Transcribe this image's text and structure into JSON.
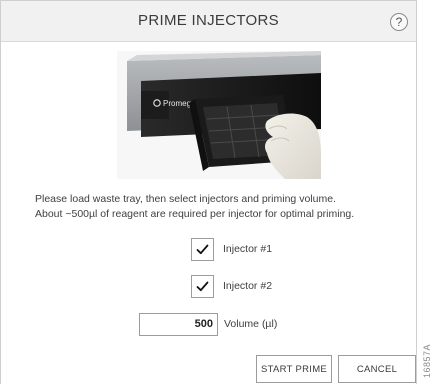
{
  "dialog": {
    "title": "PRIME INJECTORS",
    "help_label": "?"
  },
  "photo": {
    "brand": "Promega",
    "description_icon": "instrument-tray-photo"
  },
  "instructions": {
    "line1": "Please load waste tray, then select injectors and priming volume.",
    "line2": "About ~500µl of reagent are required per injector for optimal priming."
  },
  "injectors": [
    {
      "label": "Injector #1",
      "checked": true
    },
    {
      "label": "Injector #2",
      "checked": true
    }
  ],
  "volume": {
    "value": "500",
    "label": "Volume (µl)"
  },
  "buttons": {
    "start_prime": "START PRIME",
    "cancel": "CANCEL"
  },
  "figure_code": "16857A",
  "colors": {
    "titlebar_bg": "#f1f1f1",
    "border": "#9c9c9c",
    "text": "#404040"
  }
}
